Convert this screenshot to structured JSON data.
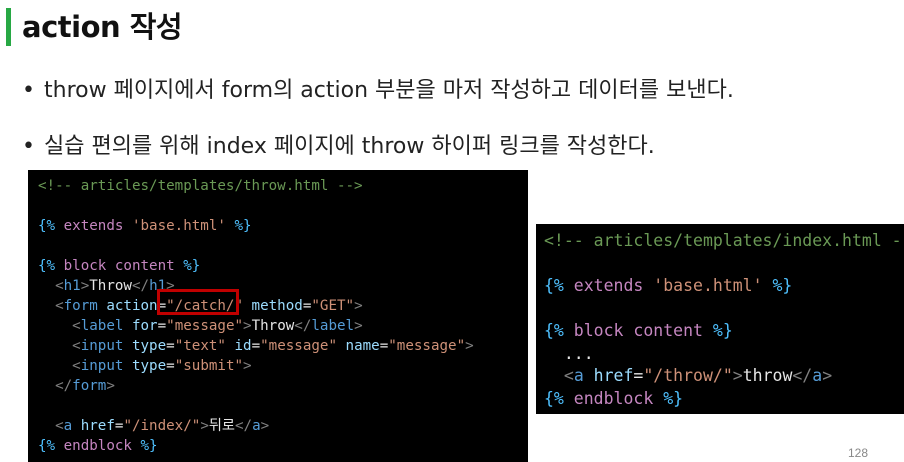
{
  "slide": {
    "title": "action 작성",
    "bullets": [
      "throw 페이지에서 form의 action 부분을 마저 작성하고 데이터를 보낸다.",
      "실습 편의를 위해 index 페이지에 throw 하이퍼 링크를 작성한다."
    ],
    "bullet_char": "•",
    "page_number": "128"
  },
  "code_throw": {
    "l1": "<!-- articles/templates/throw.html -->",
    "l3a": "{%",
    "l3b": " extends ",
    "l3c": "'base.html'",
    "l3d": " %}",
    "l5a": "{%",
    "l5b": " block content ",
    "l5c": "%}",
    "l6a": "  <",
    "l6b": "h1",
    "l6c": ">",
    "l6d": "Throw",
    "l6e": "</",
    "l6f": "h1",
    "l6g": ">",
    "l7a": "  <",
    "l7b": "form",
    "l7c": " action",
    "l7d": "=",
    "l7e": "\"/catch/\"",
    "l7f": " method",
    "l7g": "=",
    "l7h": "\"GET\"",
    "l7i": ">",
    "l8a": "    <",
    "l8b": "label",
    "l8c": " for",
    "l8d": "=",
    "l8e": "\"message\"",
    "l8f": ">",
    "l8g": "Throw",
    "l8h": "</",
    "l8i": "label",
    "l8j": ">",
    "l9a": "    <",
    "l9b": "input",
    "l9c": " type",
    "l9d": "=",
    "l9e": "\"text\"",
    "l9f": " id",
    "l9g": "=",
    "l9h": "\"message\"",
    "l9i": " name",
    "l9j": "=",
    "l9k": "\"message\"",
    "l9l": ">",
    "l10a": "    <",
    "l10b": "input",
    "l10c": " type",
    "l10d": "=",
    "l10e": "\"submit\"",
    "l10f": ">",
    "l11a": "  </",
    "l11b": "form",
    "l11c": ">",
    "l13a": "  <",
    "l13b": "a",
    "l13c": " href",
    "l13d": "=",
    "l13e": "\"/index/\"",
    "l13f": ">",
    "l13g": "뒤로",
    "l13h": "</",
    "l13i": "a",
    "l13j": ">",
    "l14a": "{%",
    "l14b": " endblock ",
    "l14c": "%}"
  },
  "code_index": {
    "l1": "<!-- articles/templates/index.html -->",
    "l3a": "{%",
    "l3b": " extends ",
    "l3c": "'base.html'",
    "l3d": " %}",
    "l5a": "{%",
    "l5b": " block content ",
    "l5c": "%}",
    "l6": "  ...",
    "l7a": "  <",
    "l7b": "a",
    "l7c": " href",
    "l7d": "=",
    "l7e": "\"/throw/\"",
    "l7f": ">",
    "l7g": "throw",
    "l7h": "</",
    "l7i": "a",
    "l7j": ">",
    "l8a": "{%",
    "l8b": " endblock ",
    "l8c": "%}"
  }
}
